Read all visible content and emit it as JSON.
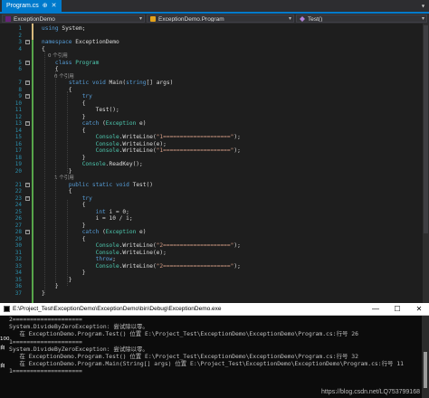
{
  "tab": {
    "label": "Program.cs",
    "close": "✕",
    "pin": "⊕"
  },
  "tabstrip": {
    "dropdown": "▾"
  },
  "navbar": {
    "project": "ExceptionDemo",
    "class": "ExceptionDemo.Program",
    "member": "Test()"
  },
  "colors": {
    "accent": "#007acc",
    "keyword": "#569cd6",
    "type": "#4ec9b0",
    "string": "#d69d85",
    "linenum": "#2b91af",
    "change": "#57a64a"
  },
  "code_lines": [
    {
      "n": "1",
      "segs": [
        {
          "t": "using ",
          "c": "kw"
        },
        {
          "t": "System;"
        }
      ]
    },
    {
      "n": "2",
      "segs": []
    },
    {
      "n": "3",
      "segs": [
        {
          "t": "namespace ",
          "c": "kw"
        },
        {
          "t": "ExceptionDemo"
        }
      ]
    },
    {
      "n": "4",
      "segs": [
        {
          "t": "{"
        }
      ]
    },
    {
      "n": "",
      "segs": [
        {
          "t": "    0 个引用",
          "c": "ref"
        }
      ]
    },
    {
      "n": "5",
      "segs": [
        {
          "t": "    "
        },
        {
          "t": "class ",
          "c": "kw"
        },
        {
          "t": "Program",
          "c": "ty"
        }
      ]
    },
    {
      "n": "6",
      "segs": [
        {
          "t": "    {"
        }
      ]
    },
    {
      "n": "",
      "segs": [
        {
          "t": "        0 个引用",
          "c": "ref"
        }
      ]
    },
    {
      "n": "7",
      "segs": [
        {
          "t": "        "
        },
        {
          "t": "static void ",
          "c": "kw"
        },
        {
          "t": "Main("
        },
        {
          "t": "string",
          "c": "kw"
        },
        {
          "t": "[] args)"
        }
      ]
    },
    {
      "n": "8",
      "segs": [
        {
          "t": "        {"
        }
      ]
    },
    {
      "n": "9",
      "segs": [
        {
          "t": "            "
        },
        {
          "t": "try",
          "c": "kw"
        }
      ]
    },
    {
      "n": "10",
      "segs": [
        {
          "t": "            {"
        }
      ]
    },
    {
      "n": "11",
      "segs": [
        {
          "t": "                Test();"
        }
      ]
    },
    {
      "n": "12",
      "segs": [
        {
          "t": "            }"
        }
      ]
    },
    {
      "n": "13",
      "segs": [
        {
          "t": "            "
        },
        {
          "t": "catch ",
          "c": "kw"
        },
        {
          "t": "("
        },
        {
          "t": "Exception",
          "c": "ty"
        },
        {
          "t": " e)"
        }
      ]
    },
    {
      "n": "14",
      "segs": [
        {
          "t": "            {"
        }
      ]
    },
    {
      "n": "15",
      "segs": [
        {
          "t": "                "
        },
        {
          "t": "Console",
          "c": "ty"
        },
        {
          "t": ".WriteLine("
        },
        {
          "t": "\"1====================\"",
          "c": "st"
        },
        {
          "t": ");"
        }
      ]
    },
    {
      "n": "16",
      "segs": [
        {
          "t": "                "
        },
        {
          "t": "Console",
          "c": "ty"
        },
        {
          "t": ".WriteLine(e);"
        }
      ]
    },
    {
      "n": "17",
      "segs": [
        {
          "t": "                "
        },
        {
          "t": "Console",
          "c": "ty"
        },
        {
          "t": ".WriteLine("
        },
        {
          "t": "\"1====================\"",
          "c": "st"
        },
        {
          "t": ");"
        }
      ]
    },
    {
      "n": "18",
      "segs": [
        {
          "t": "            }"
        }
      ]
    },
    {
      "n": "19",
      "segs": [
        {
          "t": "            "
        },
        {
          "t": "Console",
          "c": "ty"
        },
        {
          "t": ".ReadKey();"
        }
      ]
    },
    {
      "n": "20",
      "segs": [
        {
          "t": "        }"
        }
      ]
    },
    {
      "n": "",
      "segs": [
        {
          "t": "        1 个引用",
          "c": "ref"
        }
      ]
    },
    {
      "n": "21",
      "segs": [
        {
          "t": "        "
        },
        {
          "t": "public static void ",
          "c": "kw"
        },
        {
          "t": "Test()"
        }
      ]
    },
    {
      "n": "22",
      "segs": [
        {
          "t": "        {"
        }
      ]
    },
    {
      "n": "23",
      "segs": [
        {
          "t": "            "
        },
        {
          "t": "try",
          "c": "kw"
        }
      ]
    },
    {
      "n": "24",
      "segs": [
        {
          "t": "            {"
        }
      ]
    },
    {
      "n": "25",
      "segs": [
        {
          "t": "                "
        },
        {
          "t": "int ",
          "c": "kw"
        },
        {
          "t": "i = 0;"
        }
      ]
    },
    {
      "n": "26",
      "segs": [
        {
          "t": "                i = 10 / i;"
        }
      ]
    },
    {
      "n": "27",
      "segs": [
        {
          "t": "            }"
        }
      ]
    },
    {
      "n": "28",
      "segs": [
        {
          "t": "            "
        },
        {
          "t": "catch ",
          "c": "kw"
        },
        {
          "t": "("
        },
        {
          "t": "Exception",
          "c": "ty"
        },
        {
          "t": " e)"
        }
      ]
    },
    {
      "n": "29",
      "segs": [
        {
          "t": "            {"
        }
      ]
    },
    {
      "n": "30",
      "segs": [
        {
          "t": "                "
        },
        {
          "t": "Console",
          "c": "ty"
        },
        {
          "t": ".WriteLine("
        },
        {
          "t": "\"2====================\"",
          "c": "st"
        },
        {
          "t": ");"
        }
      ]
    },
    {
      "n": "31",
      "segs": [
        {
          "t": "                "
        },
        {
          "t": "Console",
          "c": "ty"
        },
        {
          "t": ".WriteLine(e);"
        }
      ]
    },
    {
      "n": "32",
      "segs": [
        {
          "t": "                "
        },
        {
          "t": "throw",
          "c": "kw"
        },
        {
          "t": ";"
        }
      ]
    },
    {
      "n": "33",
      "segs": [
        {
          "t": "                "
        },
        {
          "t": "Console",
          "c": "ty"
        },
        {
          "t": ".WriteLine("
        },
        {
          "t": "\"2====================\"",
          "c": "st"
        },
        {
          "t": ");"
        }
      ]
    },
    {
      "n": "34",
      "segs": [
        {
          "t": "            }"
        }
      ]
    },
    {
      "n": "35",
      "segs": [
        {
          "t": "        }"
        }
      ]
    },
    {
      "n": "36",
      "segs": [
        {
          "t": "    }"
        }
      ]
    },
    {
      "n": "37",
      "segs": [
        {
          "t": "}"
        }
      ]
    }
  ],
  "console": {
    "title": "E:\\Project_Test\\ExceptionDemo\\ExceptionDemo\\bin\\Debug\\ExceptionDemo.exe",
    "minimize": "—",
    "maximize": "☐",
    "close": "✕",
    "lines": [
      "2====================",
      "System.DivideByZeroException: 尝试除以零。",
      "   在 ExceptionDemo.Program.Test() 位置 E:\\Project_Test\\ExceptionDemo\\ExceptionDemo\\Program.cs:行号 26",
      "1====================",
      "System.DivideByZeroException: 尝试除以零。",
      "   在 ExceptionDemo.Program.Test() 位置 E:\\Project_Test\\ExceptionDemo\\ExceptionDemo\\Program.cs:行号 32",
      "   在 ExceptionDemo.Program.Main(String[] args) 位置 E:\\Project_Test\\ExceptionDemo\\ExceptionDemo\\Program.cs:行号 11",
      "1===================="
    ],
    "left_labels": [
      "100",
      "自",
      "自"
    ],
    "watermark": "https://blog.csdn.net/LQ753799168"
  }
}
